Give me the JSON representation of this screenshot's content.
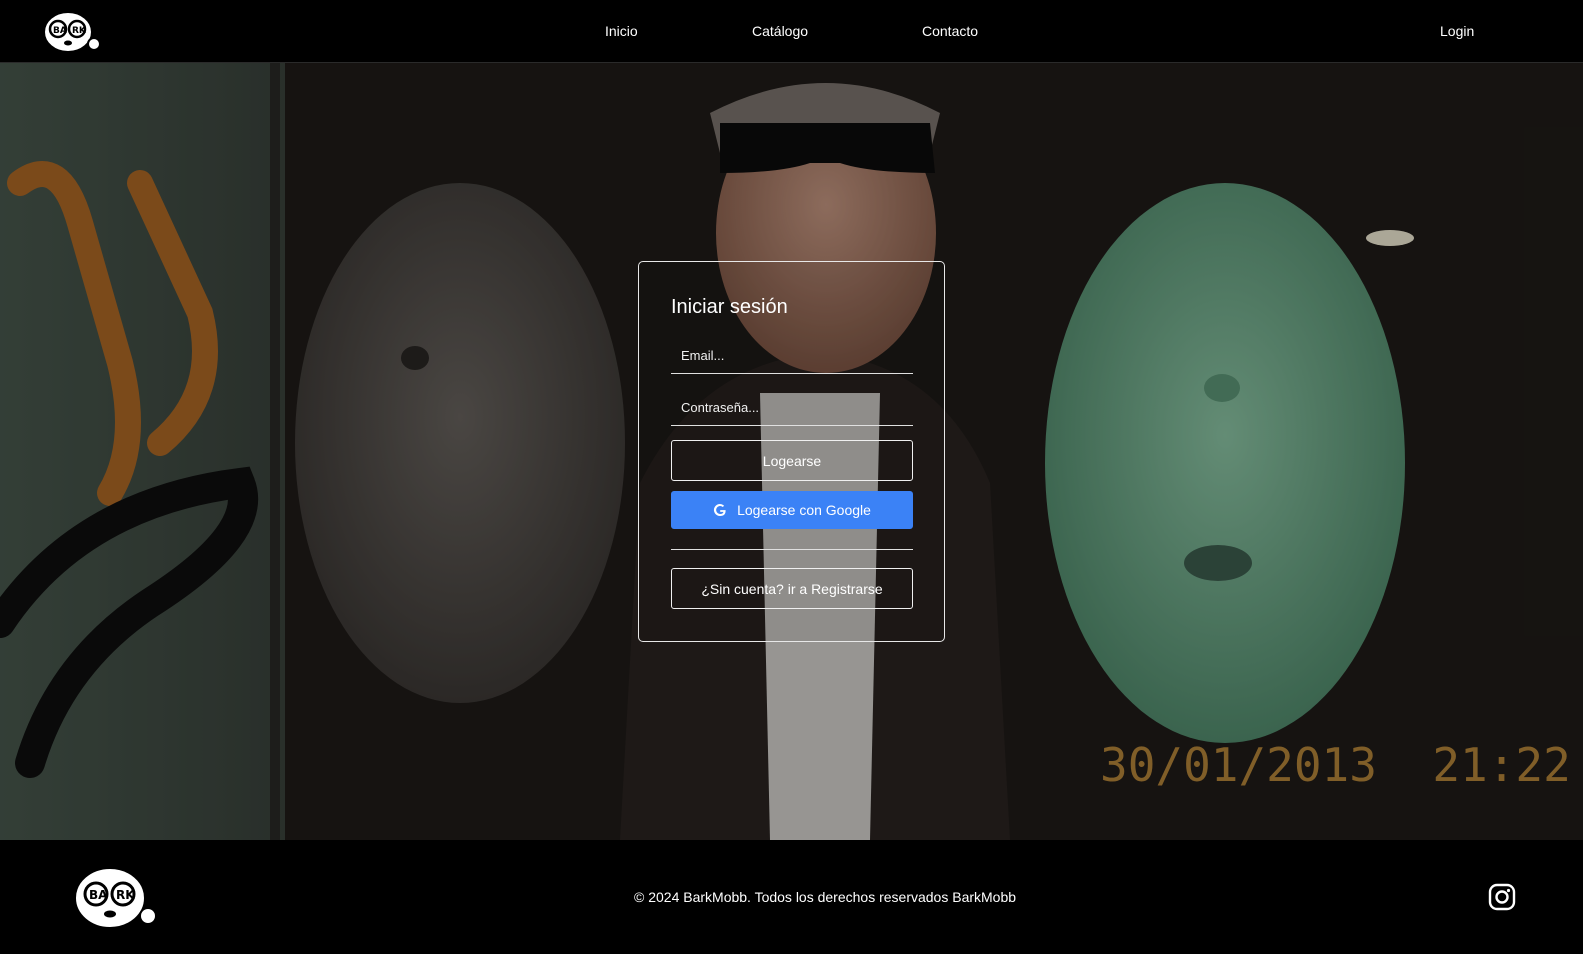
{
  "header": {
    "logo_icon": "barkmobb-logo-icon",
    "nav": [
      {
        "label": "Inicio"
      },
      {
        "label": "Catálogo"
      },
      {
        "label": "Contacto"
      }
    ],
    "login_label": "Login"
  },
  "hero": {
    "photo_timestamp": "30/01/2013  21:22"
  },
  "login_card": {
    "title": "Iniciar sesión",
    "email_placeholder": "Email...",
    "password_placeholder": "Contraseña...",
    "login_button": "Logearse",
    "google_button": "Logearse con Google",
    "google_icon": "google-g-icon",
    "register_button": "¿Sin cuenta? ir a Registrarse",
    "google_color": "#3b82f6"
  },
  "footer": {
    "copyright": "© 2024 BarkMobb. Todos los derechos reservados BarkMobb",
    "social_icon": "instagram-icon"
  }
}
